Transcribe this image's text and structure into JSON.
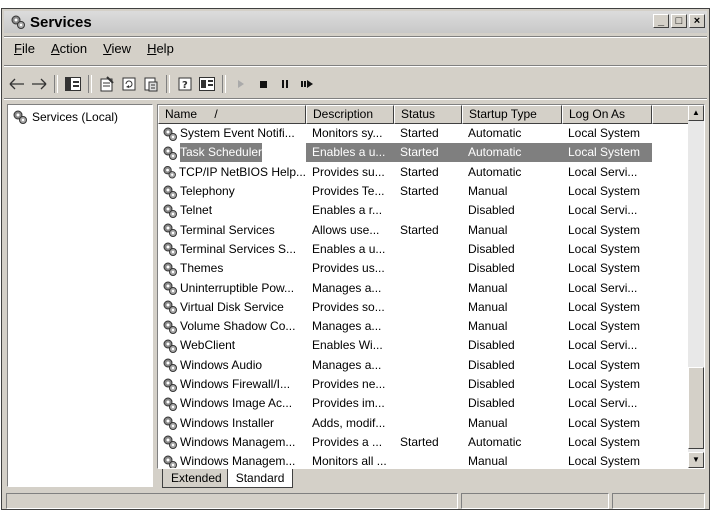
{
  "window": {
    "title": "Services"
  },
  "menu": [
    {
      "label": "File",
      "key": "F"
    },
    {
      "label": "Action",
      "key": "A"
    },
    {
      "label": "View",
      "key": "V"
    },
    {
      "label": "Help",
      "key": "H"
    }
  ],
  "tree": {
    "root_label": "Services (Local)"
  },
  "columns": [
    {
      "label": "Name",
      "sort_indicator": "/"
    },
    {
      "label": "Description"
    },
    {
      "label": "Status"
    },
    {
      "label": "Startup Type"
    },
    {
      "label": "Log On As"
    }
  ],
  "rows": [
    {
      "name": "System Event Notifi...",
      "desc": "Monitors sy...",
      "status": "Started",
      "startup": "Automatic",
      "logon": "Local System"
    },
    {
      "name": "Task Scheduler",
      "desc": "Enables a u...",
      "status": "Started",
      "startup": "Automatic",
      "logon": "Local System",
      "selected": true
    },
    {
      "name": "TCP/IP NetBIOS Help...",
      "desc": "Provides su...",
      "status": "Started",
      "startup": "Automatic",
      "logon": "Local Servi..."
    },
    {
      "name": "Telephony",
      "desc": "Provides Te...",
      "status": "Started",
      "startup": "Manual",
      "logon": "Local System"
    },
    {
      "name": "Telnet",
      "desc": "Enables a r...",
      "status": "",
      "startup": "Disabled",
      "logon": "Local Servi..."
    },
    {
      "name": "Terminal Services",
      "desc": "Allows use...",
      "status": "Started",
      "startup": "Manual",
      "logon": "Local System"
    },
    {
      "name": "Terminal Services S...",
      "desc": "Enables a u...",
      "status": "",
      "startup": "Disabled",
      "logon": "Local System"
    },
    {
      "name": "Themes",
      "desc": "Provides us...",
      "status": "",
      "startup": "Disabled",
      "logon": "Local System"
    },
    {
      "name": "Uninterruptible Pow...",
      "desc": "Manages a...",
      "status": "",
      "startup": "Manual",
      "logon": "Local Servi..."
    },
    {
      "name": "Virtual Disk Service",
      "desc": "Provides so...",
      "status": "",
      "startup": "Manual",
      "logon": "Local System"
    },
    {
      "name": "Volume Shadow Co...",
      "desc": "Manages a...",
      "status": "",
      "startup": "Manual",
      "logon": "Local System"
    },
    {
      "name": "WebClient",
      "desc": "Enables Wi...",
      "status": "",
      "startup": "Disabled",
      "logon": "Local Servi..."
    },
    {
      "name": "Windows Audio",
      "desc": "Manages a...",
      "status": "",
      "startup": "Disabled",
      "logon": "Local System"
    },
    {
      "name": "Windows Firewall/I...",
      "desc": "Provides ne...",
      "status": "",
      "startup": "Disabled",
      "logon": "Local System"
    },
    {
      "name": "Windows Image Ac...",
      "desc": "Provides im...",
      "status": "",
      "startup": "Disabled",
      "logon": "Local Servi..."
    },
    {
      "name": "Windows Installer",
      "desc": "Adds, modif...",
      "status": "",
      "startup": "Manual",
      "logon": "Local System"
    },
    {
      "name": "Windows Managem...",
      "desc": "Provides a ...",
      "status": "Started",
      "startup": "Automatic",
      "logon": "Local System"
    },
    {
      "name": "Windows Managem...",
      "desc": "Monitors all ...",
      "status": "",
      "startup": "Manual",
      "logon": "Local System"
    }
  ],
  "tabs": [
    {
      "label": "Extended"
    },
    {
      "label": "Standard",
      "active": true
    }
  ],
  "icons": {
    "app": "services-gear-icon",
    "back": "back-arrow-icon",
    "forward": "forward-arrow-icon",
    "play": "play-icon",
    "stop": "stop-icon",
    "pause": "pause-icon",
    "restart": "restart-icon"
  }
}
